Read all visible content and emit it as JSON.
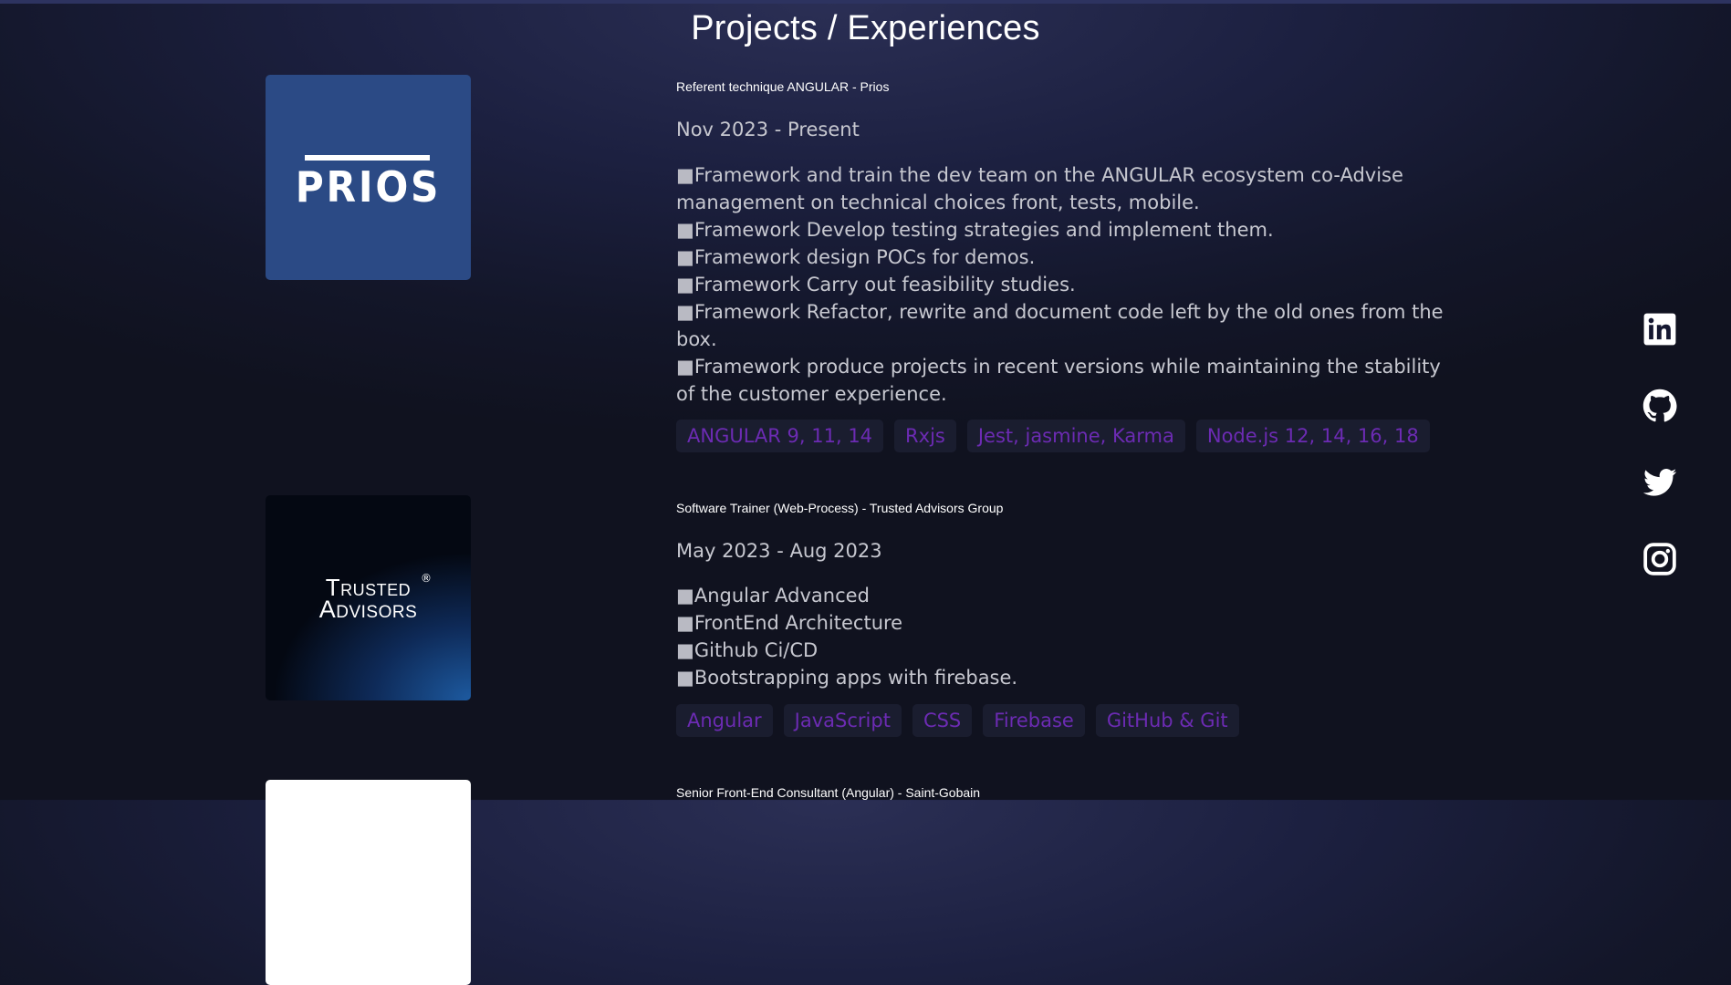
{
  "page": {
    "title": "Projects / Experiences"
  },
  "experiences": [
    {
      "logo": {
        "text": "PRIOS",
        "bg": "#2b4a85"
      },
      "role": "Referent technique ANGULAR - Prios",
      "dates": "Nov 2023 - Present",
      "bullets": [
        "Framework and train the dev team on the ANGULAR ecosystem co-Advise management on technical choices front, tests, mobile.",
        "Framework Develop testing strategies and implement them.",
        "Framework design POCs for demos.",
        "Framework Carry out feasibility studies.",
        "Framework Refactor, rewrite and document code left by the old ones from the box.",
        "Framework produce projects in recent versions while maintaining the stability of the customer experience."
      ],
      "tags": [
        "ANGULAR 9, 11, 14",
        "Rxjs",
        "Jest, jasmine, Karma",
        "Node.js 12, 14, 16, 18"
      ]
    },
    {
      "logo": {
        "line1": "Trusted",
        "line2": "Advisors",
        "reg": "®"
      },
      "role": "Software Trainer (Web-Process) - Trusted Advisors Group",
      "dates": "May 2023 - Aug 2023",
      "bullets": [
        "Angular Advanced",
        "FrontEnd Architecture",
        "Github Ci/CD",
        "Bootstrapping apps with firebase."
      ],
      "tags": [
        "Angular",
        "JavaScript",
        "CSS",
        "Firebase",
        "GitHub & Git"
      ]
    },
    {
      "role": "Senior Front-End Consultant (Angular) - Saint-Gobain"
    }
  ],
  "bullet_glyph": "■",
  "social": [
    {
      "icon": "linkedin-icon"
    },
    {
      "icon": "github-icon"
    },
    {
      "icon": "twitter-icon"
    },
    {
      "icon": "instagram-icon"
    }
  ],
  "colors": {
    "tag_text": "#6c2bb3",
    "tag_bg": "#1a1d2f",
    "background": "#131629"
  }
}
